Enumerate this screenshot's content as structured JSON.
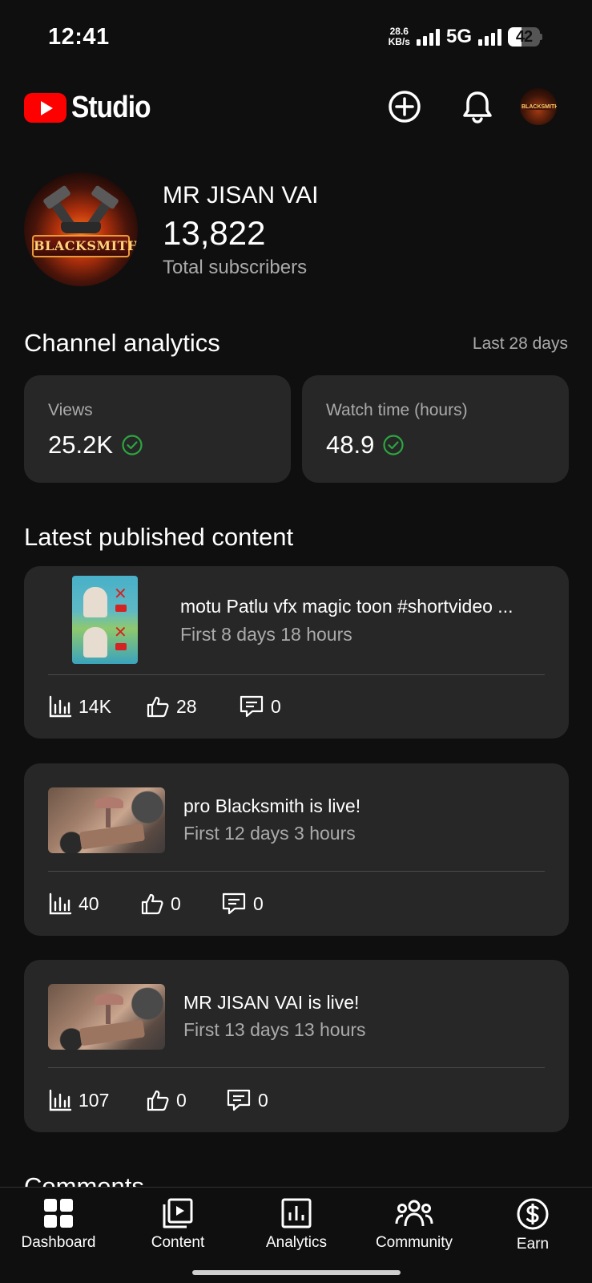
{
  "status_bar": {
    "time": "12:41",
    "net_speed_value": "28.6",
    "net_speed_unit": "KB/s",
    "network": "5G",
    "battery": "42"
  },
  "header": {
    "app_name": "Studio",
    "icons": [
      "plus-circle-icon",
      "bell-icon",
      "channel-avatar"
    ]
  },
  "channel": {
    "avatar_text": "BLACKSMITH",
    "name": "MR JISAN VAI",
    "subscribers": "13,822",
    "subscribers_label": "Total subscribers"
  },
  "analytics": {
    "title": "Channel analytics",
    "range": "Last 28 days",
    "cards": [
      {
        "label": "Views",
        "value": "25.2K"
      },
      {
        "label": "Watch time (hours)",
        "value": "48.9"
      }
    ]
  },
  "latest": {
    "title": "Latest published content",
    "items": [
      {
        "title": "motu Patlu vfx magic toon #shortvideo ...",
        "sub": "First 8 days 18 hours",
        "views": "14K",
        "likes": "28",
        "comments": "0"
      },
      {
        "title": "pro Blacksmith is live!",
        "sub": "First 12 days 3 hours",
        "views": "40",
        "likes": "0",
        "comments": "0"
      },
      {
        "title": "MR JISAN VAI is live!",
        "sub": "First 13 days 13 hours",
        "views": "107",
        "likes": "0",
        "comments": "0"
      }
    ]
  },
  "comments_heading": "Comments",
  "nav": {
    "items": [
      {
        "label": "Dashboard"
      },
      {
        "label": "Content"
      },
      {
        "label": "Analytics"
      },
      {
        "label": "Community"
      },
      {
        "label": "Earn"
      }
    ]
  },
  "colors": {
    "background": "#0f0f0f",
    "card": "#272727",
    "brand_red": "#ff0000",
    "check_green": "#2ba640",
    "secondary_text": "#aaaaaa"
  }
}
